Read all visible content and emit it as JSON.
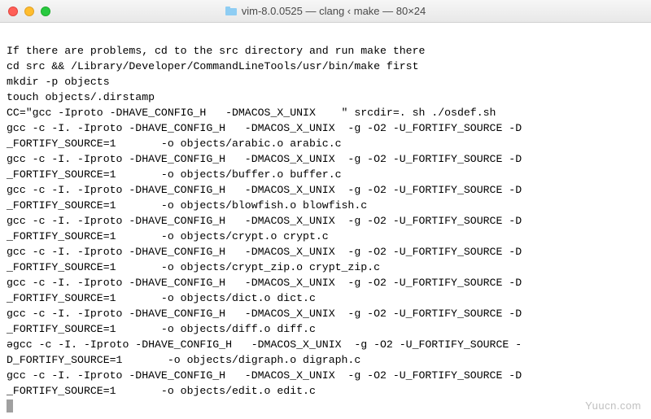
{
  "window": {
    "title": "vim-8.0.0525 — clang ‹ make — 80×24"
  },
  "terminal": {
    "lines": [
      "If there are problems, cd to the src directory and run make there",
      "cd src && /Library/Developer/CommandLineTools/usr/bin/make first",
      "mkdir -p objects",
      "touch objects/.dirstamp",
      "CC=\"gcc -Iproto -DHAVE_CONFIG_H   -DMACOS_X_UNIX    \" srcdir=. sh ./osdef.sh",
      "gcc -c -I. -Iproto -DHAVE_CONFIG_H   -DMACOS_X_UNIX  -g -O2 -U_FORTIFY_SOURCE -D",
      "_FORTIFY_SOURCE=1       -o objects/arabic.o arabic.c",
      "gcc -c -I. -Iproto -DHAVE_CONFIG_H   -DMACOS_X_UNIX  -g -O2 -U_FORTIFY_SOURCE -D",
      "_FORTIFY_SOURCE=1       -o objects/buffer.o buffer.c",
      "gcc -c -I. -Iproto -DHAVE_CONFIG_H   -DMACOS_X_UNIX  -g -O2 -U_FORTIFY_SOURCE -D",
      "_FORTIFY_SOURCE=1       -o objects/blowfish.o blowfish.c",
      "gcc -c -I. -Iproto -DHAVE_CONFIG_H   -DMACOS_X_UNIX  -g -O2 -U_FORTIFY_SOURCE -D",
      "_FORTIFY_SOURCE=1       -o objects/crypt.o crypt.c",
      "gcc -c -I. -Iproto -DHAVE_CONFIG_H   -DMACOS_X_UNIX  -g -O2 -U_FORTIFY_SOURCE -D",
      "_FORTIFY_SOURCE=1       -o objects/crypt_zip.o crypt_zip.c",
      "gcc -c -I. -Iproto -DHAVE_CONFIG_H   -DMACOS_X_UNIX  -g -O2 -U_FORTIFY_SOURCE -D",
      "_FORTIFY_SOURCE=1       -o objects/dict.o dict.c",
      "gcc -c -I. -Iproto -DHAVE_CONFIG_H   -DMACOS_X_UNIX  -g -O2 -U_FORTIFY_SOURCE -D",
      "_FORTIFY_SOURCE=1       -o objects/diff.o diff.c",
      "əgcc -c -I. -Iproto -DHAVE_CONFIG_H   -DMACOS_X_UNIX  -g -O2 -U_FORTIFY_SOURCE -",
      "D_FORTIFY_SOURCE=1       -o objects/digraph.o digraph.c",
      "gcc -c -I. -Iproto -DHAVE_CONFIG_H   -DMACOS_X_UNIX  -g -O2 -U_FORTIFY_SOURCE -D",
      "_FORTIFY_SOURCE=1       -o objects/edit.o edit.c"
    ]
  },
  "watermark": "Yuucn.com"
}
